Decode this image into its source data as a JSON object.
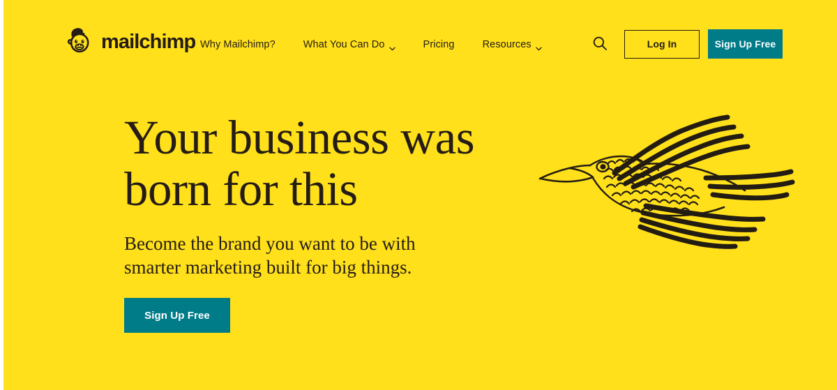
{
  "theme": {
    "background_yellow": "#FFE01B",
    "ink": "#241C15",
    "accent_teal": "#007C89",
    "button_text": "#FFFFFF"
  },
  "header": {
    "brand": {
      "wordmark": "mailchimp",
      "logo_icon": "freddie-monkey-head-icon"
    },
    "nav": [
      {
        "label": "Why Mailchimp?",
        "has_dropdown": false
      },
      {
        "label": "What You Can Do",
        "has_dropdown": true
      },
      {
        "label": "Pricing",
        "has_dropdown": false
      },
      {
        "label": "Resources",
        "has_dropdown": true
      }
    ],
    "search_icon": "search-icon",
    "login_label": "Log In",
    "signup_label": "Sign Up Free"
  },
  "hero": {
    "title_line_1": "Your business was",
    "title_line_2": "born for this",
    "subtitle": "Become the brand you want to be with smarter marketing built for big things.",
    "cta_label": "Sign Up Free",
    "illustration": "flying-bird-illustration"
  }
}
